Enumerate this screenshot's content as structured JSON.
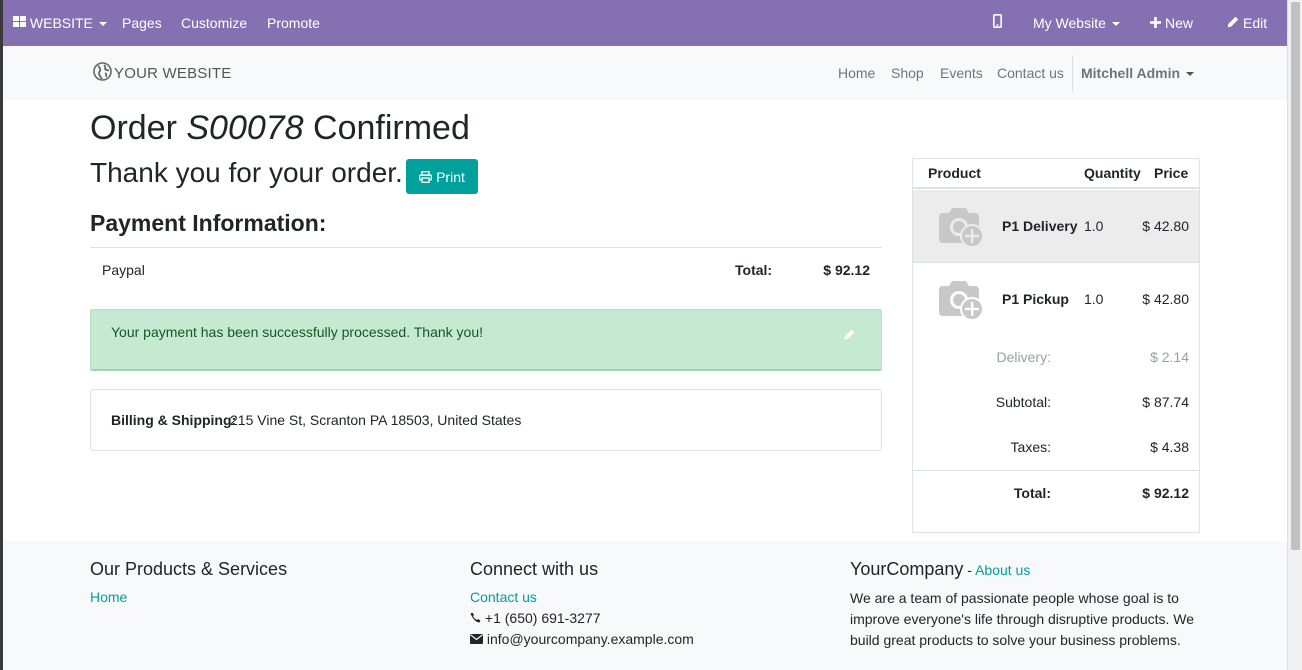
{
  "adminbar": {
    "website_menu": "WEBSITE",
    "pages": "Pages",
    "customize": "Customize",
    "promote": "Promote",
    "my_website": "My Website",
    "new": "New",
    "edit": "Edit"
  },
  "header": {
    "logo_text": "YOUR WEBSITE",
    "nav": [
      "Home",
      "Shop",
      "Events",
      "Contact us"
    ],
    "user": "Mitchell Admin"
  },
  "order": {
    "title_prefix": "Order ",
    "order_ref": "S00078",
    "title_suffix": " Confirmed",
    "thanks": "Thank you for your order.",
    "print_label": "Print",
    "payment_heading": "Payment Information:",
    "payment_method": "Paypal",
    "total_label": "Total:",
    "total_value": "$ 92.12",
    "success_message": "Your payment has been successfully processed. Thank you!",
    "billing_label": "Billing & Shipping:",
    "billing_address": "215 Vine St, Scranton PA 18503, United States"
  },
  "cart": {
    "headers": {
      "product": "Product",
      "quantity": "Quantity",
      "price": "Price"
    },
    "items": [
      {
        "name": "P1 Delivery",
        "qty": "1.0",
        "price": "$ 42.80"
      },
      {
        "name": "P1 Pickup",
        "qty": "1.0",
        "price": "$ 42.80"
      }
    ],
    "delivery_label": "Delivery:",
    "delivery_value": "$ 2.14",
    "subtotal_label": "Subtotal:",
    "subtotal_value": "$ 87.74",
    "taxes_label": "Taxes:",
    "taxes_value": "$ 4.38",
    "total_label": "Total:",
    "total_value": "$ 92.12"
  },
  "footer": {
    "col1_title": "Our Products & Services",
    "col1_link": "Home",
    "col2_title": "Connect with us",
    "col2_link": "Contact us",
    "phone": "+1 (650) 691-3277",
    "email": "info@yourcompany.example.com",
    "col3_title": "YourCompany",
    "col3_sep": " - ",
    "col3_link": "About us",
    "about_text": "We are a team of passionate people whose goal is to improve everyone's life through disruptive products. We build great products to solve your business problems."
  },
  "colors": {
    "admin_bar": "#8570b2",
    "accent": "#00a09d",
    "success_bg": "#c6e9d2"
  }
}
